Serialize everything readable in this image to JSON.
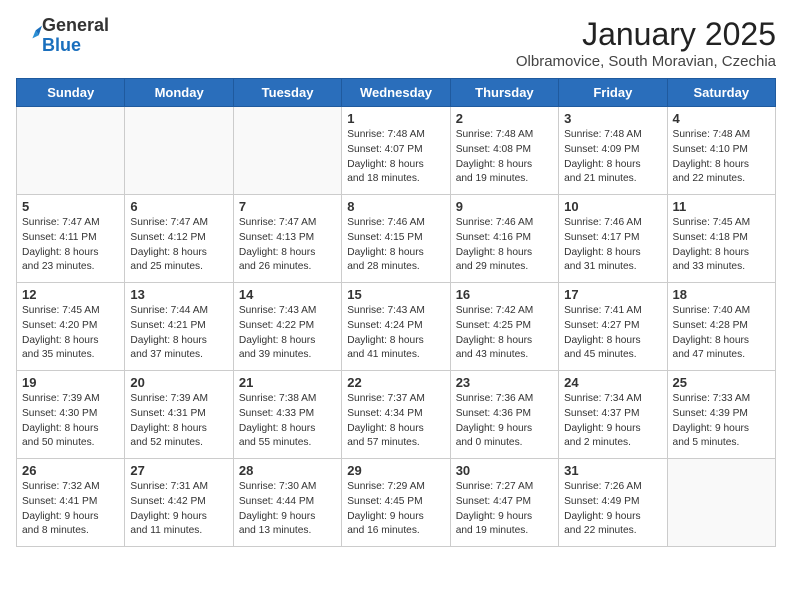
{
  "logo": {
    "general": "General",
    "blue": "Blue"
  },
  "header": {
    "month": "January 2025",
    "location": "Olbramovice, South Moravian, Czechia"
  },
  "weekdays": [
    "Sunday",
    "Monday",
    "Tuesday",
    "Wednesday",
    "Thursday",
    "Friday",
    "Saturday"
  ],
  "weeks": [
    [
      {
        "day": "",
        "info": ""
      },
      {
        "day": "",
        "info": ""
      },
      {
        "day": "",
        "info": ""
      },
      {
        "day": "1",
        "info": "Sunrise: 7:48 AM\nSunset: 4:07 PM\nDaylight: 8 hours\nand 18 minutes."
      },
      {
        "day": "2",
        "info": "Sunrise: 7:48 AM\nSunset: 4:08 PM\nDaylight: 8 hours\nand 19 minutes."
      },
      {
        "day": "3",
        "info": "Sunrise: 7:48 AM\nSunset: 4:09 PM\nDaylight: 8 hours\nand 21 minutes."
      },
      {
        "day": "4",
        "info": "Sunrise: 7:48 AM\nSunset: 4:10 PM\nDaylight: 8 hours\nand 22 minutes."
      }
    ],
    [
      {
        "day": "5",
        "info": "Sunrise: 7:47 AM\nSunset: 4:11 PM\nDaylight: 8 hours\nand 23 minutes."
      },
      {
        "day": "6",
        "info": "Sunrise: 7:47 AM\nSunset: 4:12 PM\nDaylight: 8 hours\nand 25 minutes."
      },
      {
        "day": "7",
        "info": "Sunrise: 7:47 AM\nSunset: 4:13 PM\nDaylight: 8 hours\nand 26 minutes."
      },
      {
        "day": "8",
        "info": "Sunrise: 7:46 AM\nSunset: 4:15 PM\nDaylight: 8 hours\nand 28 minutes."
      },
      {
        "day": "9",
        "info": "Sunrise: 7:46 AM\nSunset: 4:16 PM\nDaylight: 8 hours\nand 29 minutes."
      },
      {
        "day": "10",
        "info": "Sunrise: 7:46 AM\nSunset: 4:17 PM\nDaylight: 8 hours\nand 31 minutes."
      },
      {
        "day": "11",
        "info": "Sunrise: 7:45 AM\nSunset: 4:18 PM\nDaylight: 8 hours\nand 33 minutes."
      }
    ],
    [
      {
        "day": "12",
        "info": "Sunrise: 7:45 AM\nSunset: 4:20 PM\nDaylight: 8 hours\nand 35 minutes."
      },
      {
        "day": "13",
        "info": "Sunrise: 7:44 AM\nSunset: 4:21 PM\nDaylight: 8 hours\nand 37 minutes."
      },
      {
        "day": "14",
        "info": "Sunrise: 7:43 AM\nSunset: 4:22 PM\nDaylight: 8 hours\nand 39 minutes."
      },
      {
        "day": "15",
        "info": "Sunrise: 7:43 AM\nSunset: 4:24 PM\nDaylight: 8 hours\nand 41 minutes."
      },
      {
        "day": "16",
        "info": "Sunrise: 7:42 AM\nSunset: 4:25 PM\nDaylight: 8 hours\nand 43 minutes."
      },
      {
        "day": "17",
        "info": "Sunrise: 7:41 AM\nSunset: 4:27 PM\nDaylight: 8 hours\nand 45 minutes."
      },
      {
        "day": "18",
        "info": "Sunrise: 7:40 AM\nSunset: 4:28 PM\nDaylight: 8 hours\nand 47 minutes."
      }
    ],
    [
      {
        "day": "19",
        "info": "Sunrise: 7:39 AM\nSunset: 4:30 PM\nDaylight: 8 hours\nand 50 minutes."
      },
      {
        "day": "20",
        "info": "Sunrise: 7:39 AM\nSunset: 4:31 PM\nDaylight: 8 hours\nand 52 minutes."
      },
      {
        "day": "21",
        "info": "Sunrise: 7:38 AM\nSunset: 4:33 PM\nDaylight: 8 hours\nand 55 minutes."
      },
      {
        "day": "22",
        "info": "Sunrise: 7:37 AM\nSunset: 4:34 PM\nDaylight: 8 hours\nand 57 minutes."
      },
      {
        "day": "23",
        "info": "Sunrise: 7:36 AM\nSunset: 4:36 PM\nDaylight: 9 hours\nand 0 minutes."
      },
      {
        "day": "24",
        "info": "Sunrise: 7:34 AM\nSunset: 4:37 PM\nDaylight: 9 hours\nand 2 minutes."
      },
      {
        "day": "25",
        "info": "Sunrise: 7:33 AM\nSunset: 4:39 PM\nDaylight: 9 hours\nand 5 minutes."
      }
    ],
    [
      {
        "day": "26",
        "info": "Sunrise: 7:32 AM\nSunset: 4:41 PM\nDaylight: 9 hours\nand 8 minutes."
      },
      {
        "day": "27",
        "info": "Sunrise: 7:31 AM\nSunset: 4:42 PM\nDaylight: 9 hours\nand 11 minutes."
      },
      {
        "day": "28",
        "info": "Sunrise: 7:30 AM\nSunset: 4:44 PM\nDaylight: 9 hours\nand 13 minutes."
      },
      {
        "day": "29",
        "info": "Sunrise: 7:29 AM\nSunset: 4:45 PM\nDaylight: 9 hours\nand 16 minutes."
      },
      {
        "day": "30",
        "info": "Sunrise: 7:27 AM\nSunset: 4:47 PM\nDaylight: 9 hours\nand 19 minutes."
      },
      {
        "day": "31",
        "info": "Sunrise: 7:26 AM\nSunset: 4:49 PM\nDaylight: 9 hours\nand 22 minutes."
      },
      {
        "day": "",
        "info": ""
      }
    ]
  ]
}
